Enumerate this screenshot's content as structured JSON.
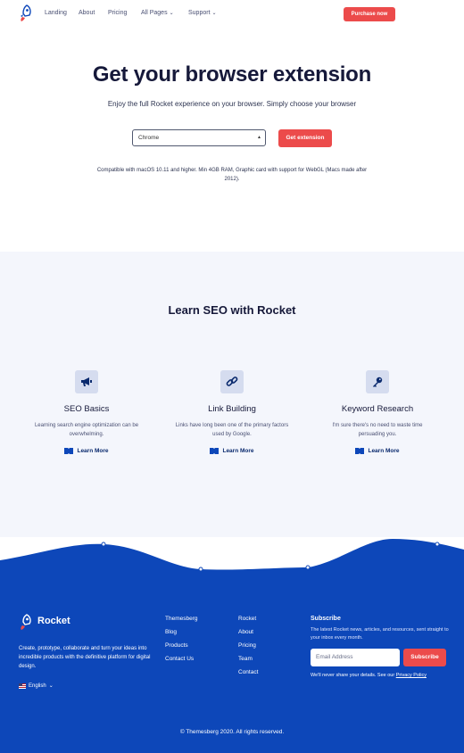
{
  "nav": {
    "items": [
      {
        "label": "Landing"
      },
      {
        "label": "About"
      },
      {
        "label": "Pricing"
      },
      {
        "label": "All Pages"
      },
      {
        "label": "Support"
      }
    ],
    "purchase_label": "Purchase now"
  },
  "hero": {
    "title": "Get your browser extension",
    "subtitle": "Enjoy the full Rocket experience on your browser. Simply choose your browser",
    "browser_value": "Chrome",
    "cta_label": "Get extension",
    "note": "Compatible with macOS 10.11 and higher. Min 4GB RAM, Graphic card with support for WebGL (Macs made after 2012)."
  },
  "seo": {
    "title": "Learn SEO with Rocket",
    "features": [
      {
        "title": "SEO Basics",
        "desc": "Learning search engine optimization can be overwhelming.",
        "link": "Learn More",
        "icon": "megaphone-icon"
      },
      {
        "title": "Link Building",
        "desc": "Links have long been one of the primary factors used by Google.",
        "link": "Learn More",
        "icon": "link-icon"
      },
      {
        "title": "Keyword Research",
        "desc": "I'm sure there's no need to waste time persuading you.",
        "link": "Learn More",
        "icon": "key-icon"
      }
    ]
  },
  "footer": {
    "brand": "Rocket",
    "description": "Create, prototype, collaborate and turn your ideas into incredible products with the definitive platform for digital design.",
    "language": "English",
    "col1": [
      "Themesberg",
      "Blog",
      "Products",
      "Contact Us"
    ],
    "col2": [
      "Rocket",
      "About",
      "Pricing",
      "Team",
      "Contact"
    ],
    "subscribe_title": "Subscribe",
    "subscribe_desc": "The latest Rocket news, articles, and resources, sent straight to your inbox every month.",
    "email_placeholder": "Email Address",
    "subscribe_label": "Subscribe",
    "privacy_text": "We'll never share your details. See our",
    "privacy_link": "Privacy Policy",
    "copyright": "© Themesberg 2020. All rights reserved."
  },
  "colors": {
    "accent": "#ec4b4b",
    "footer_blue": "#0d47b9",
    "section_bg": "#f4f6fc"
  }
}
